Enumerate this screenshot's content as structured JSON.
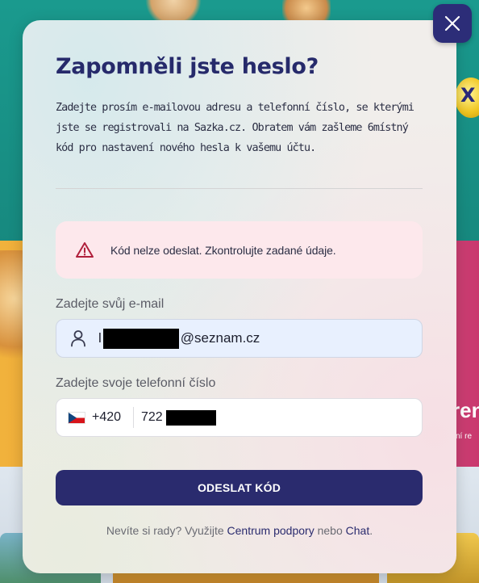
{
  "background": {
    "peek_text": "ren",
    "peek_subtext": "ční re",
    "ball_letter": "X"
  },
  "modal": {
    "title": "Zapomněli jste heslo?",
    "description": "Zadejte prosím e-mailovou adresu a telefonní číslo, se kterými jste se registrovali na Sazka.cz. Obratem vám zašleme 6místný kód pro nastavení nového hesla k vašemu účtu.",
    "close_icon": "close-icon",
    "alert": {
      "icon": "warning-triangle-icon",
      "text": "Kód nelze odeslat. Zkontrolujte zadané údaje.",
      "color": "#b0203c",
      "background": "#fde8ec"
    },
    "email": {
      "label": "Zadejte svůj e-mail",
      "icon": "user-icon",
      "value_prefix": "l",
      "value_suffix": "@seznam.cz",
      "redacted": true
    },
    "phone": {
      "label": "Zadejte svoje telefonní číslo",
      "country_flag": "czech-flag-icon",
      "dial_code": "+420",
      "value_prefix": "722",
      "redacted": true
    },
    "submit_label": "ODESLAT KÓD",
    "help": {
      "text_before": "Nevíte si rady? Využijte",
      "link_support": "Centrum podpory",
      "text_middle": "nebo",
      "link_chat": "Chat",
      "text_after": "."
    }
  },
  "colors": {
    "primary": "#2a2b6e",
    "title": "#262a6b",
    "input_autofill": "#e8f0fe"
  }
}
